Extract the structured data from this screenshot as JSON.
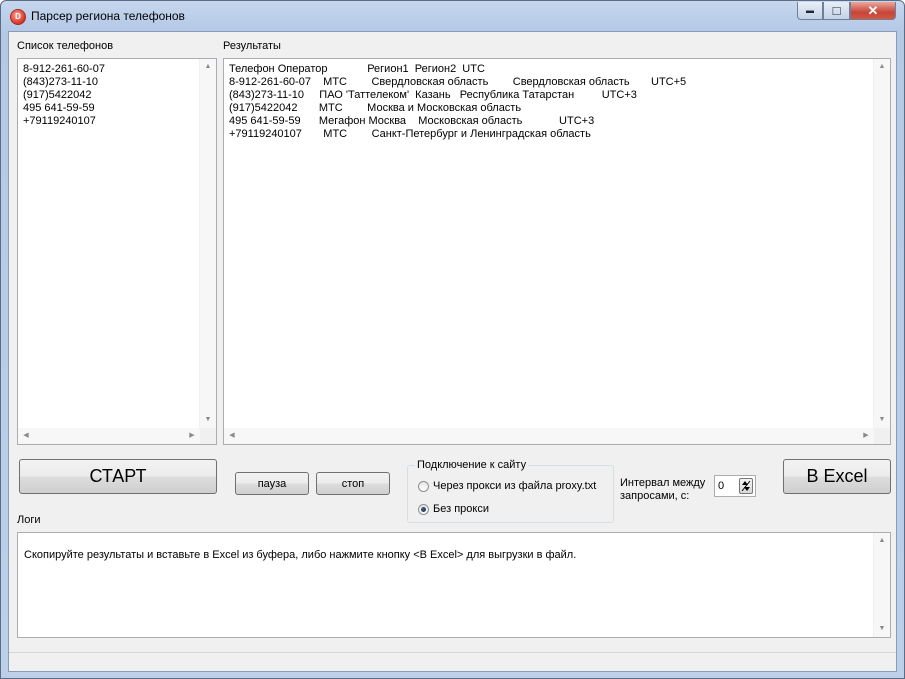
{
  "window": {
    "title": "Парсер региона телефонов",
    "icon_letter": "D",
    "minimize_glyph": "▬",
    "maximize_glyph": "□",
    "close_glyph": "✕"
  },
  "phones": {
    "label": "Список телефонов",
    "text": "8-912-261-60-07\n(843)273-11-10\n(917)5422042\n495 641-59-59\n+79119240107"
  },
  "results": {
    "label": "Результаты",
    "text": "Телефон Оператор             Регион1  Регион2  UTC\n8-912-261-60-07    МТС        Свердловская область        Свердловская область       UTC+5\n(843)273-11-10     ПАО 'Таттелеком'  Казань   Республика Татарстан         UTC+3\n(917)5422042       МТС        Москва и Московская область\n495 641-59-59      Мегафон Москва    Московская область            UTC+3\n+79119240107       МТС        Санкт-Петербург и Ленинградская область"
  },
  "controls": {
    "start_label": "СТАРТ",
    "pause_label": "пауза",
    "stop_label": "стоп",
    "excel_label": "В Excel"
  },
  "connection": {
    "title": "Подключение к сайту",
    "option_proxy": "Через прокси из файла proxy.txt",
    "option_noproxy": "Без прокси",
    "selected": "Без прокси"
  },
  "interval": {
    "label_line1": "Интервал между",
    "label_line2": "запросами, с:",
    "value": "0"
  },
  "logs": {
    "label": "Логи",
    "text": "Скопируйте результаты и вставьте в Excel из буфера, либо нажмите кнопку <В Excel> для выгрузки в файл."
  }
}
